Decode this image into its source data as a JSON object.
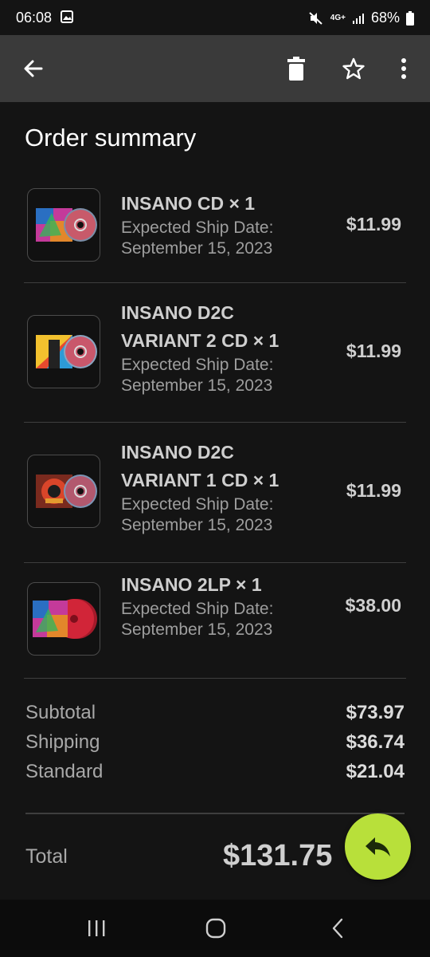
{
  "status_bar": {
    "time": "06:08",
    "battery": "68%",
    "network": "4G+"
  },
  "app_bar": {
    "icons": [
      "back-arrow-icon",
      "delete-icon",
      "star-icon",
      "more-vert-icon"
    ]
  },
  "title": "Order summary",
  "items": [
    {
      "name": "INSANO CD × 1",
      "ship_label": "Expected Ship Date:",
      "ship_date": "September 15, 2023",
      "price": "$11.99"
    },
    {
      "name": "INSANO D2C VARIANT 2 CD × 1",
      "ship_label": "Expected Ship Date:",
      "ship_date": "September 15, 2023",
      "price": "$11.99"
    },
    {
      "name": "INSANO D2C VARIANT 1 CD × 1",
      "ship_label": "Expected Ship Date:",
      "ship_date": "September 15, 2023",
      "price": "$11.99"
    },
    {
      "name": "INSANO 2LP × 1",
      "ship_label": "Expected Ship Date:",
      "ship_date": "September 15, 2023",
      "price": "$38.00"
    }
  ],
  "totals": [
    {
      "label": "Subtotal",
      "value": "$73.97"
    },
    {
      "label": "Shipping",
      "value": "$36.74"
    },
    {
      "label": "Standard",
      "value": "$21.04"
    }
  ],
  "total": {
    "label": "Total",
    "value": "$131.75"
  },
  "fab": {
    "icon": "reply-icon",
    "color": "#b8e03a"
  },
  "nav_bar": {
    "icons": [
      "recents-icon",
      "home-icon",
      "back-icon"
    ]
  }
}
